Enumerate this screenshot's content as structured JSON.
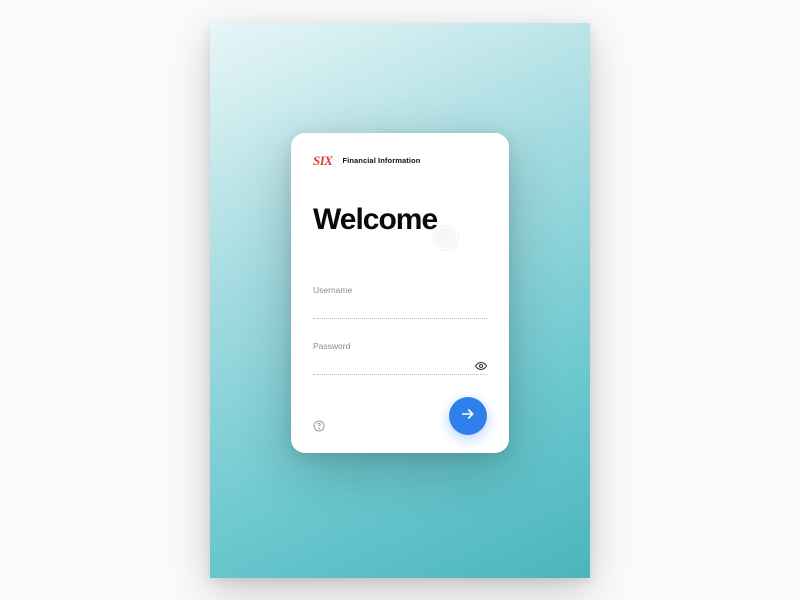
{
  "brand": {
    "logo_text": "SIX",
    "subtitle": "Financial Information"
  },
  "title": "Welcome",
  "form": {
    "username": {
      "label": "Username",
      "value": ""
    },
    "password": {
      "label": "Password",
      "value": ""
    }
  },
  "colors": {
    "accent": "#2F80ED",
    "brand": "#E03C31"
  }
}
